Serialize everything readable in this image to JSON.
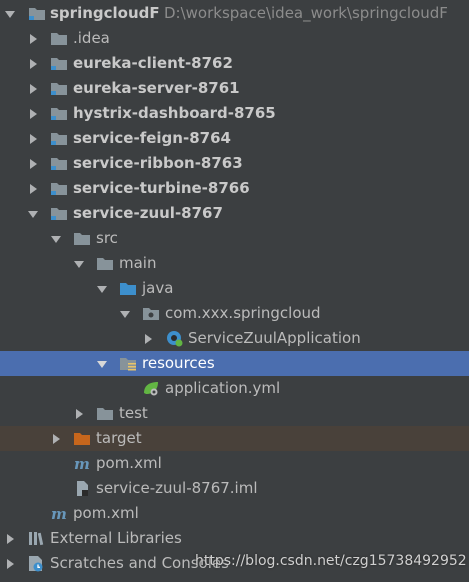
{
  "project": {
    "name": "springcloudF",
    "path": "D:\\workspace\\idea_work\\springcloudF"
  },
  "nodes": {
    "idea": ".idea",
    "eureka_client": "eureka-client-8762",
    "eureka_server": "eureka-server-8761",
    "hystrix": "hystrix-dashboard-8765",
    "feign": "service-feign-8764",
    "ribbon": "service-ribbon-8763",
    "turbine": "service-turbine-8766",
    "zuul": "service-zuul-8767",
    "src": "src",
    "main": "main",
    "java": "java",
    "package": "com.xxx.springcloud",
    "app_class": "ServiceZuulApplication",
    "resources": "resources",
    "app_yml": "application.yml",
    "test": "test",
    "target": "target",
    "zuul_pom": "pom.xml",
    "zuul_iml": "service-zuul-8767.iml",
    "root_pom": "pom.xml",
    "external_libraries": "External Libraries",
    "scratches": "Scratches and Consoles"
  },
  "watermark": "https://blog.csdn.net/czg15738492952",
  "colors": {
    "background": "#3c3f41",
    "selection": "#4b6eaf",
    "excluded": "#49413a",
    "folder": "#87939a",
    "source_folder": "#3d8fcc",
    "excluded_folder": "#c7661c"
  }
}
